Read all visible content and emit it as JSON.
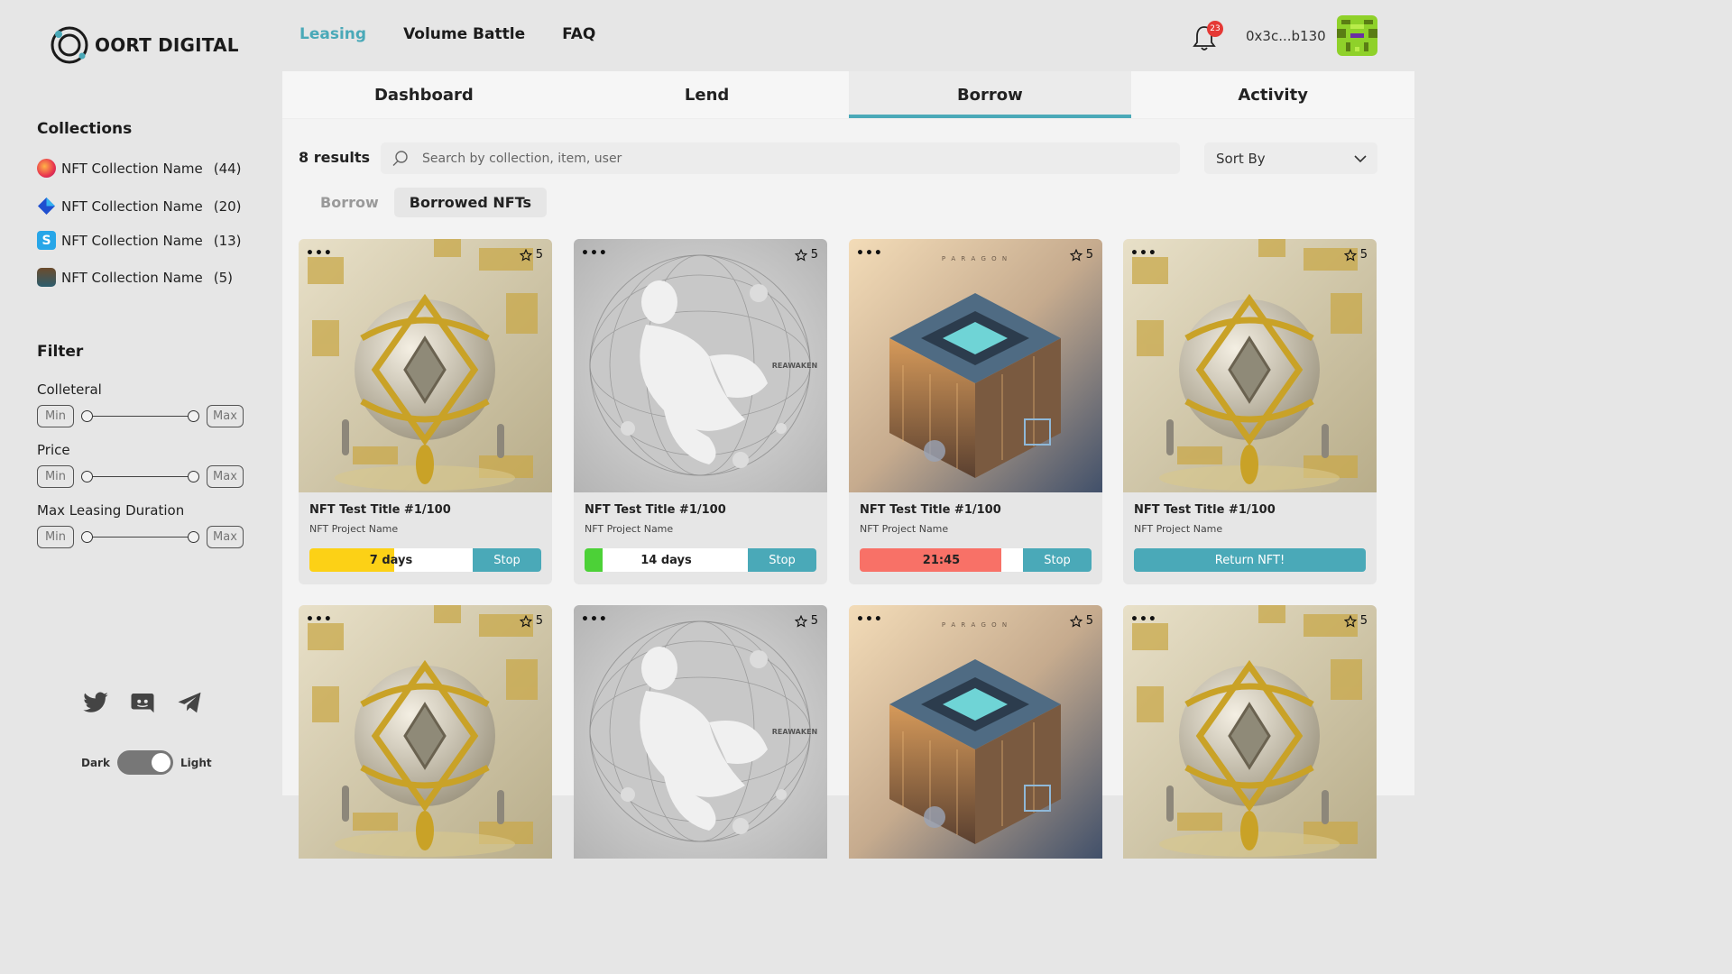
{
  "brand": {
    "name": "OORT DIGITAL",
    "accent": "#4aa9b8"
  },
  "nav": {
    "items": [
      "Leasing",
      "Volume Battle",
      "FAQ"
    ],
    "active": "Leasing"
  },
  "header": {
    "notification_count": "23",
    "wallet": "0x3c...b130"
  },
  "sidebar": {
    "collections_title": "Collections",
    "collections": [
      {
        "name": "NFT Collection Name",
        "count": "(44)",
        "icon": "flame-logo-icon"
      },
      {
        "name": "NFT Collection Name",
        "count": "(20)",
        "icon": "diamond-logo-icon"
      },
      {
        "name": "NFT Collection Name",
        "count": "(13)",
        "icon": "s-logo-icon"
      },
      {
        "name": "NFT Collection Name",
        "count": "(5)",
        "icon": "tiki-logo-icon"
      }
    ],
    "filter_title": "Filter",
    "filters": [
      {
        "label": "Colleteral",
        "min_placeholder": "Min",
        "max_placeholder": "Max"
      },
      {
        "label": "Price",
        "min_placeholder": "Min",
        "max_placeholder": "Max"
      },
      {
        "label": "Max Leasing Duration",
        "min_placeholder": "Min",
        "max_placeholder": "Max"
      }
    ],
    "socials": [
      "twitter-icon",
      "discord-icon",
      "telegram-icon"
    ],
    "theme": {
      "dark_label": "Dark",
      "light_label": "Light",
      "selected": "Light"
    }
  },
  "main": {
    "tabs": [
      "Dashboard",
      "Lend",
      "Borrow",
      "Activity"
    ],
    "active_tab": "Borrow",
    "results": "8 results",
    "search_placeholder": "Search by collection, item, user",
    "sort_label": "Sort By",
    "subtabs": [
      "Borrow",
      "Borrowed NFTs"
    ],
    "active_subtab": "Borrowed NFTs",
    "cards": [
      {
        "title": "NFT Test Title #1/100",
        "project": "NFT Project Name",
        "favorites": "5",
        "art": "golden-sphere",
        "status": "7 days",
        "progress": 0.52,
        "progress_color": "#fcd116",
        "action": "Stop"
      },
      {
        "title": "NFT Test Title #1/100",
        "project": "NFT Project Name",
        "favorites": "5",
        "art": "reawaken-figure",
        "status": "14 days",
        "progress": 0.11,
        "progress_color": "#4cd137",
        "action": "Stop"
      },
      {
        "title": "NFT Test Title #1/100",
        "project": "NFT Project Name",
        "favorites": "5",
        "art": "paragon-cube",
        "status": "21:45",
        "progress": 0.87,
        "progress_color": "#f87167",
        "action": "Stop"
      },
      {
        "title": "NFT Test Title #1/100",
        "project": "NFT Project Name",
        "favorites": "5",
        "art": "golden-sphere",
        "status": "",
        "progress": null,
        "progress_color": "",
        "action": "Return NFT!"
      },
      {
        "title": "",
        "project": "",
        "favorites": "5",
        "art": "golden-sphere"
      },
      {
        "title": "",
        "project": "",
        "favorites": "5",
        "art": "reawaken-figure"
      },
      {
        "title": "",
        "project": "",
        "favorites": "5",
        "art": "paragon-cube"
      },
      {
        "title": "",
        "project": "",
        "favorites": "5",
        "art": "golden-sphere"
      }
    ],
    "art_labels": {
      "reawaken": "REAWAKEN",
      "paragon": "P A R A G O N"
    }
  }
}
